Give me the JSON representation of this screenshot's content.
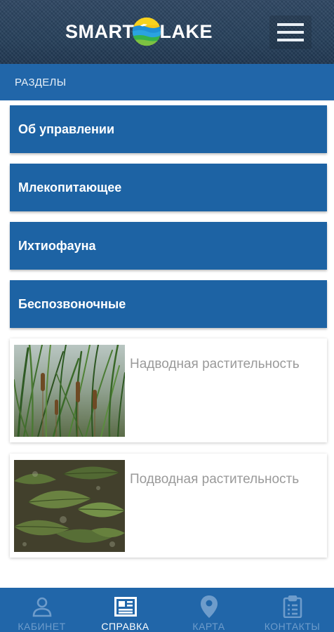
{
  "header": {
    "logo_word_left": "SMART",
    "logo_word_right": "LAKE",
    "menu_icon": "hamburger-menu-icon"
  },
  "section": {
    "title": "РАЗДЕЛЫ"
  },
  "categories": [
    {
      "label": "Об управлении"
    },
    {
      "label": "Млекопитающее"
    },
    {
      "label": "Ихтиофауна"
    },
    {
      "label": "Беспозвоночные"
    }
  ],
  "cards": [
    {
      "title": "Надводная растительность",
      "image": "reeds-photo"
    },
    {
      "title": "Подводная растительность",
      "image": "underwater-leaves-photo"
    }
  ],
  "bottom_nav": {
    "items": [
      {
        "label": "КАБИНЕТ",
        "icon": "person-icon",
        "active": false
      },
      {
        "label": "СПРАВКА",
        "icon": "newspaper-icon",
        "active": true
      },
      {
        "label": "КАРТА",
        "icon": "map-pin-icon",
        "active": false
      },
      {
        "label": "КОНТАКТЫ",
        "icon": "clipboard-icon",
        "active": false
      }
    ]
  },
  "colors": {
    "primary": "#2166a9",
    "button": "#1d63a4",
    "header_bg": "#26405b",
    "nav_inactive": "#6e9ccb",
    "card_text": "#9a9a9a"
  }
}
